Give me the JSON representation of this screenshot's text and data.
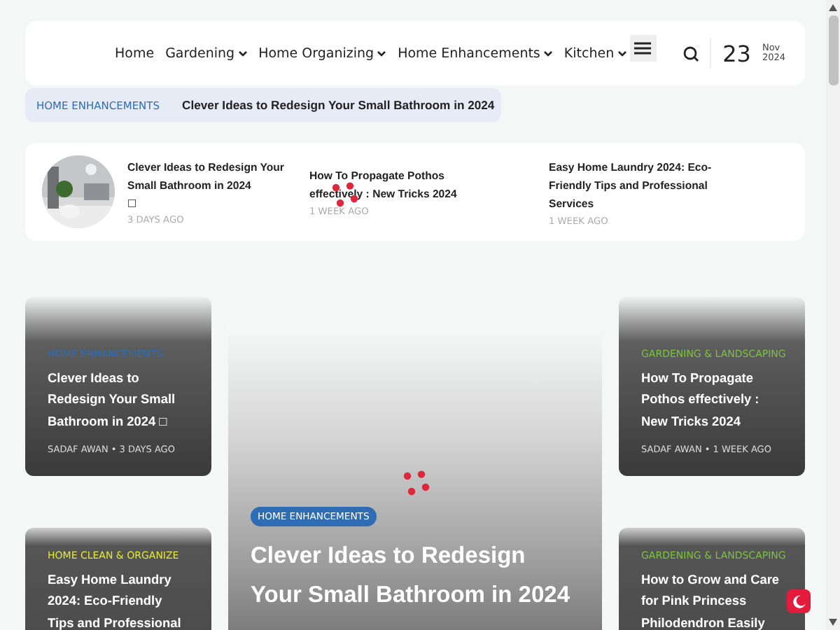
{
  "header": {
    "nav": [
      {
        "label": "Home",
        "dropdown": false
      },
      {
        "label": "Gardening",
        "dropdown": true
      },
      {
        "label": "Home Organizing",
        "dropdown": true
      },
      {
        "label": "Home Enhancements",
        "dropdown": true
      },
      {
        "label": "Kitchen",
        "dropdown": true
      }
    ],
    "date": {
      "day": "23",
      "month": "Nov",
      "year": "2024"
    }
  },
  "breadcrumb": {
    "category": "HOME ENHANCEMENTS",
    "title": "Clever Ideas to Redesign Your Small Bathroom in 2024"
  },
  "ticker": [
    {
      "title": "Clever Ideas to Redesign Your Small Bathroom in 2024",
      "glyph": "□",
      "time": "3 DAYS AGO",
      "thumbnail": true,
      "loading": false
    },
    {
      "title": "How To Propagate Pothos effectively : New Tricks 2024",
      "time": "1 WEEK AGO",
      "thumbnail": false,
      "loading": true
    },
    {
      "title": "Easy Home Laundry 2024: Eco-Friendly Tips and Professional Services",
      "time": "1 WEEK AGO",
      "thumbnail": false,
      "loading": false
    }
  ],
  "left_cards": [
    {
      "category": "HOME ENHANCEMENTS",
      "color": "#2e6db4",
      "title": "Clever Ideas to Redesign Your Small Bathroom in 2024 □",
      "byline": "SADAF AWAN • 3 DAYS AGO"
    },
    {
      "category": "HOME CLEAN & ORGANIZE",
      "color": "#e4e83a",
      "title": "Easy Home Laundry 2024: Eco-Friendly Tips and Professional"
    }
  ],
  "featured": {
    "category": "HOME ENHANCEMENTS",
    "title": "Clever Ideas to Redesign Your Small Bathroom in 2024",
    "loading": true
  },
  "right_cards": [
    {
      "category": "GARDENING & LANDSCAPING",
      "color": "#7cc242",
      "title": "How To Propagate Pothos effectively : New Tricks 2024",
      "byline": "SADAF AWAN • 1 WEEK AGO"
    },
    {
      "category": "GARDENING & LANDSCAPING",
      "color": "#7cc242",
      "title": "How to Grow and Care for Pink Princess Philodendron Easily"
    }
  ],
  "dark_mode": false
}
